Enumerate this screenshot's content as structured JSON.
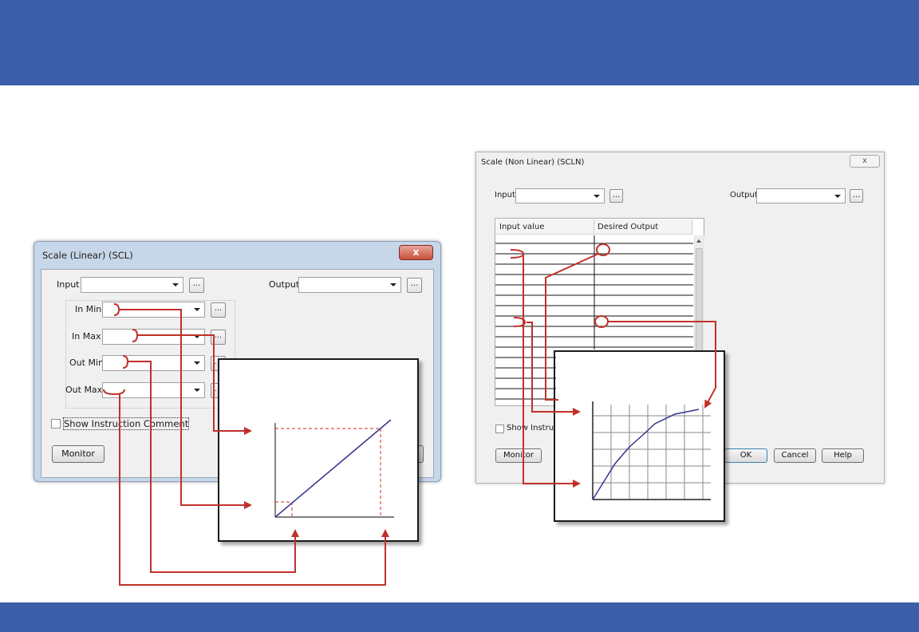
{
  "colors": {
    "band": "#3d5ea8",
    "accent_red": "#c0312a",
    "curve": "#33338f"
  },
  "linear_dialog": {
    "title": "Scale (Linear) (SCL)",
    "close_glyph": "x",
    "input_label": "Input",
    "output_label": "Output",
    "in_min_label": "In Min",
    "in_max_label": "In Max",
    "out_min_label": "Out Min",
    "out_max_label": "Out Max",
    "browse_label": "...",
    "show_comment_label": "Show Instruction Comment",
    "monitor_label": "Monitor"
  },
  "nonlinear_dialog": {
    "title": "Scale (Non Linear) (SCLN)",
    "close_glyph": "x",
    "input_label": "Input",
    "output_label": "Output",
    "browse_label": "...",
    "columns": [
      "Input value",
      "Desired Output"
    ],
    "show_comment_label": "Show Instructio",
    "monitor_label": "Monitor",
    "ok_label": "OK",
    "cancel_label": "Cancel",
    "help_label": "Help"
  }
}
